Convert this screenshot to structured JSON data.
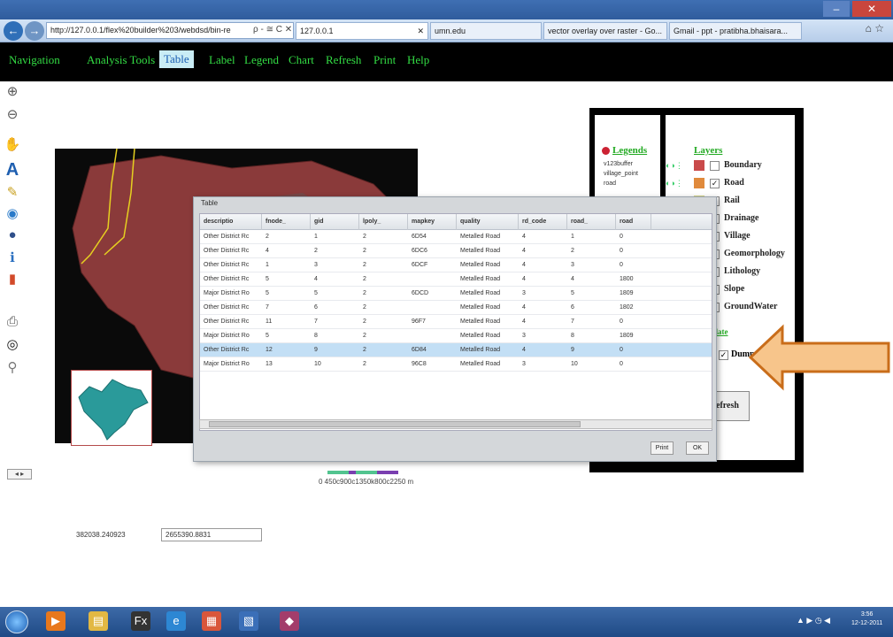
{
  "browser": {
    "url": "http://127.0.0.1/flex%20builder%203/webdsd/bin-re",
    "url_controls": "ρ - ≅ C ✕",
    "tabs": [
      {
        "label": "127.0.0.1",
        "close": "✕"
      },
      {
        "label": "umn.edu"
      },
      {
        "label": "vector overlay over raster - Go..."
      },
      {
        "label": "Gmail - ppt - pratibha.bhaisara..."
      }
    ],
    "window_min": "–",
    "window_close": "✕",
    "nav_back": "←",
    "nav_forward": "→",
    "home_star": "⌂ ☆"
  },
  "menu": {
    "items": [
      {
        "label": "Navigation"
      },
      {
        "label": "Analysis Tools"
      },
      {
        "label": "Table",
        "active": true
      },
      {
        "label": "Label"
      },
      {
        "label": "Legend"
      },
      {
        "label": "Chart"
      },
      {
        "label": "Refresh"
      },
      {
        "label": "Print"
      },
      {
        "label": "Help"
      }
    ]
  },
  "tools": [
    {
      "icon": "zoom-in-icon",
      "glyph": "⊕"
    },
    {
      "icon": "zoom-out-icon",
      "glyph": "⊖"
    },
    {
      "icon": "pan-icon",
      "glyph": "✋"
    },
    {
      "icon": "text-label-icon",
      "glyph": "A"
    },
    {
      "icon": "edit-pencil-icon",
      "glyph": "✎"
    },
    {
      "icon": "globe-icon",
      "glyph": "◉"
    },
    {
      "icon": "full-extent-icon",
      "glyph": "●"
    },
    {
      "icon": "info-icon",
      "glyph": "ℹ"
    },
    {
      "icon": "chart-icon",
      "glyph": "▮"
    },
    {
      "icon": "print-icon",
      "glyph": "⎙"
    },
    {
      "icon": "identify-icon",
      "glyph": "◎"
    },
    {
      "icon": "search-icon",
      "glyph": "⚲"
    }
  ],
  "legend": {
    "title": "Legends",
    "items": [
      "v123buffer",
      "village_point",
      "road"
    ]
  },
  "layers": {
    "title": "Layers",
    "items": [
      {
        "name": "Boundary",
        "checked": false,
        "color": "#c94a4a"
      },
      {
        "name": "Road",
        "checked": true,
        "color": "#e08a3c"
      },
      {
        "name": "Rail",
        "checked": false,
        "color": "#d9d98a"
      },
      {
        "name": "Drainage",
        "checked": false
      },
      {
        "name": "Village",
        "checked": false
      },
      {
        "name": "Geomorphology",
        "checked": false
      },
      {
        "name": "Lithology",
        "checked": false
      },
      {
        "name": "Slope",
        "checked": false
      },
      {
        "name": "GroundWater",
        "checked": false
      }
    ],
    "update_label": "date",
    "dump_label": "Dump",
    "dump_checked": true,
    "refresh_label": "efresh"
  },
  "table_dialog": {
    "title": "Table",
    "columns": [
      "descriptio",
      "fnode_",
      "gid",
      "lpoly_",
      "mapkey",
      "quality",
      "rd_code",
      "road_",
      "road"
    ],
    "rows": [
      [
        "Other District Rc",
        "2",
        "1",
        "2",
        "6D54",
        "Metalled Road",
        "4",
        "1",
        "0"
      ],
      [
        "Other District Rc",
        "4",
        "2",
        "2",
        "6DC6",
        "Metalled Road",
        "4",
        "2",
        "0"
      ],
      [
        "Other District Rc",
        "1",
        "3",
        "2",
        "6DCF",
        "Metalled Road",
        "4",
        "3",
        "0"
      ],
      [
        "Other District Rc",
        "5",
        "4",
        "2",
        "",
        "Metalled Road",
        "4",
        "4",
        "1800"
      ],
      [
        "Major District Ro",
        "5",
        "5",
        "2",
        "6DCD",
        "Metalled Road",
        "3",
        "5",
        "1809"
      ],
      [
        "Other District Rc",
        "7",
        "6",
        "2",
        "",
        "Metalled Road",
        "4",
        "6",
        "1802"
      ],
      [
        "Other District Rc",
        "11",
        "7",
        "2",
        "96F7",
        "Metalled Road",
        "4",
        "7",
        "0"
      ],
      [
        "Major District Ro",
        "5",
        "8",
        "2",
        "",
        "Metalled Road",
        "3",
        "8",
        "1809"
      ],
      [
        "Other District Rc",
        "12",
        "9",
        "2",
        "6D84",
        "Metalled Road",
        "4",
        "9",
        "0"
      ],
      [
        "Major District Ro",
        "13",
        "10",
        "2",
        "96C8",
        "Metalled Road",
        "3",
        "10",
        "0"
      ]
    ],
    "selected_row": 8,
    "print_label": "Print",
    "ok_label": "OK"
  },
  "map": {
    "scale_text": "0 450c900c1350k800c2250 m",
    "zoom_text": "◂ ▸"
  },
  "coords": {
    "x": "382038.240923",
    "y": "2655390.8831"
  },
  "taskbar": {
    "tray": "▲ ▶ ◷ ◀",
    "time": "3:56",
    "date": "12-12-2011",
    "items": [
      {
        "icon": "media-player-icon",
        "glyph": "▶",
        "color": "#e8781c"
      },
      {
        "icon": "folder-icon",
        "glyph": "▤",
        "color": "#e2b843"
      },
      {
        "icon": "flex-icon",
        "glyph": "Fx",
        "color": "#333"
      },
      {
        "icon": "ie-icon",
        "glyph": "e",
        "color": "#2d87d3"
      },
      {
        "icon": "paint-icon",
        "glyph": "▦",
        "color": "#d9563b"
      },
      {
        "icon": "editor-icon",
        "glyph": "▧",
        "color": "#3b6fb8"
      },
      {
        "icon": "winrar-icon",
        "glyph": "◆",
        "color": "#a33d6b"
      }
    ]
  }
}
